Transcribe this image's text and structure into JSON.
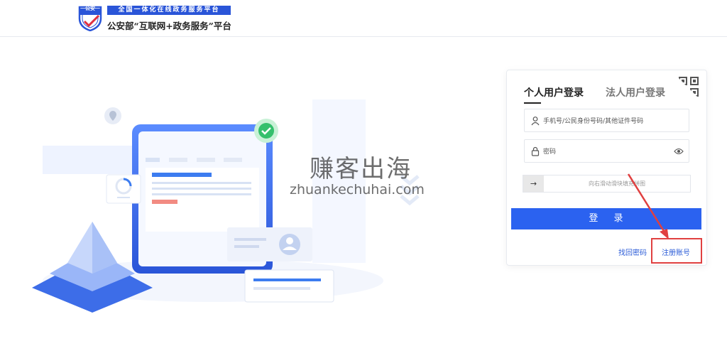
{
  "header": {
    "badge_text": "公安",
    "platform_slogan": "全国一体化在线政务服务平台",
    "platform_name": "公安部“互联网+政务服务”平台"
  },
  "watermark": {
    "cn": "赚客出海",
    "en": "zhuankechuhai.com"
  },
  "login": {
    "tabs": [
      {
        "label": "个人用户登录",
        "active": true
      },
      {
        "label": "法人用户登录",
        "active": false
      }
    ],
    "account_placeholder": "手机号/公民身份号码/其他证件号码",
    "password_placeholder": "密码",
    "slider_handle": "→",
    "slider_text": "向右滑动滑块填充拼图",
    "submit_label": "登 录",
    "forgot_label": "找回密码",
    "register_label": "注册账号"
  },
  "colors": {
    "accent": "#2b62f0",
    "brand": "#2a55d8",
    "annotation": "#e04040"
  }
}
